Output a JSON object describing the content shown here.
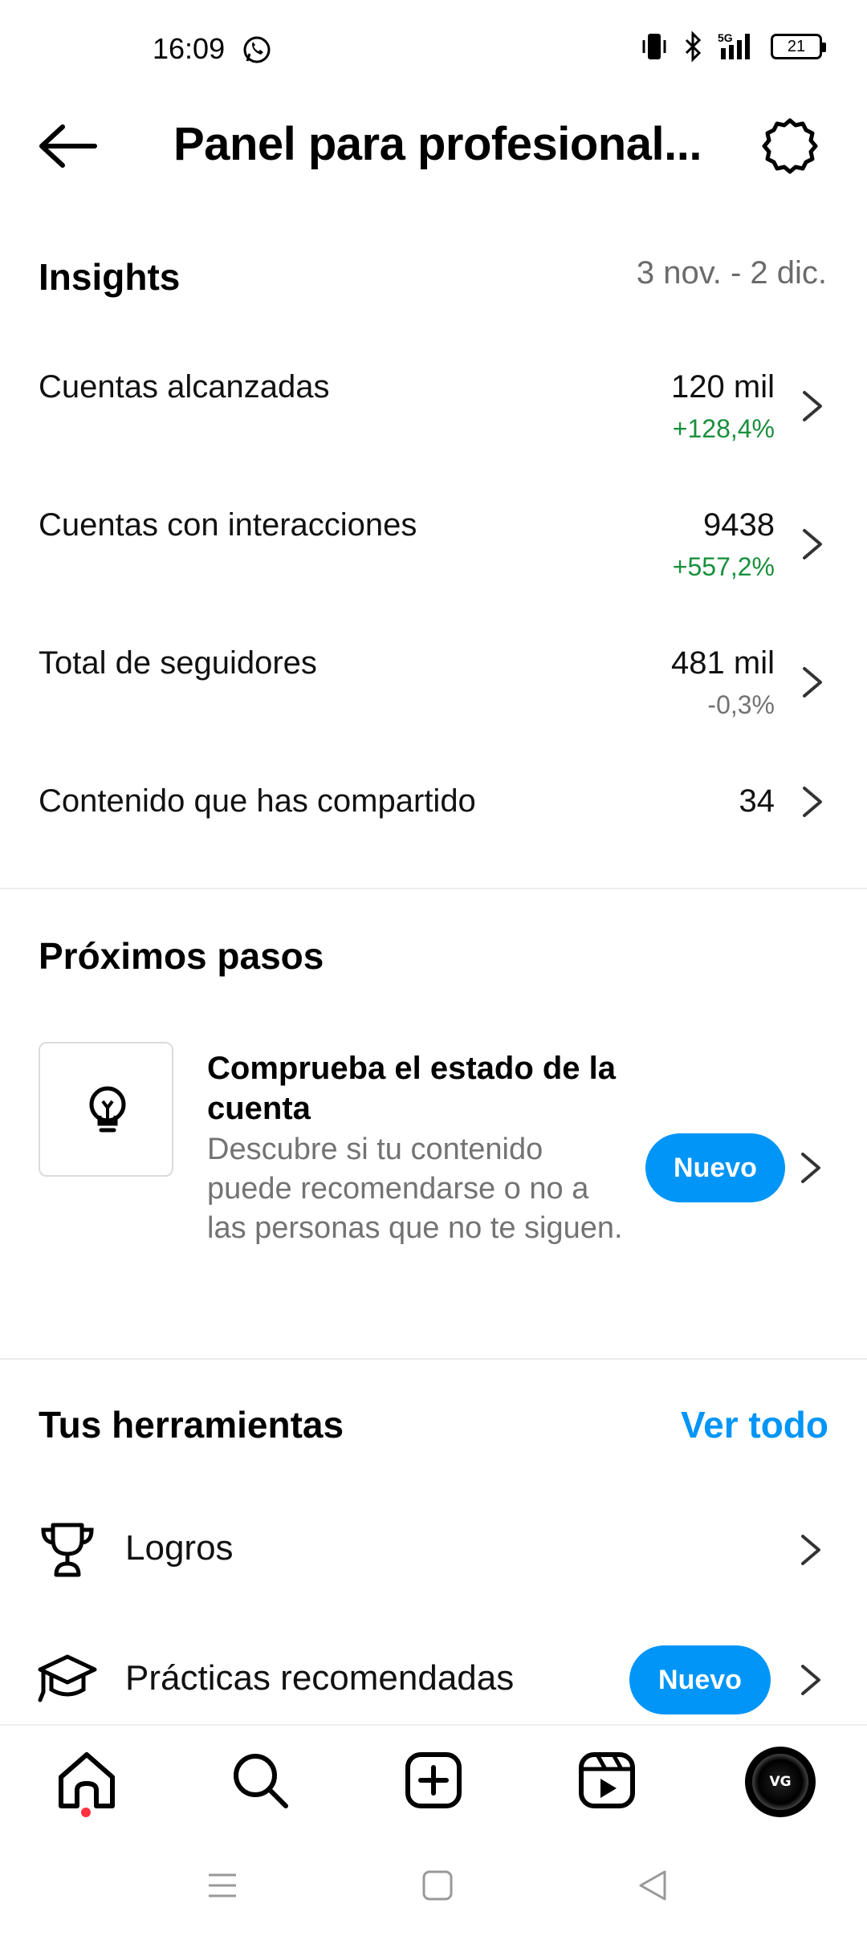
{
  "status_bar": {
    "time": "16:09",
    "network": "5G",
    "battery": "21"
  },
  "header": {
    "title": "Panel para profesional..."
  },
  "insights": {
    "title": "Insights",
    "date_range": "3 nov. - 2 dic.",
    "metrics": [
      {
        "label": "Cuentas alcanzadas",
        "value": "120 mil",
        "change": "+128,4%"
      },
      {
        "label": "Cuentas con interacciones",
        "value": "9438",
        "change": "+557,2%"
      },
      {
        "label": "Total de seguidores",
        "value": "481 mil",
        "change": "-0,3%"
      },
      {
        "label": "Contenido que has compartido",
        "value": "34",
        "change": ""
      }
    ]
  },
  "next_steps": {
    "title": "Próximos pasos",
    "card": {
      "title": "Comprueba el estado de la cuenta",
      "description": "Descubre si tu contenido puede recomendarse o no a las personas que no te siguen.",
      "badge": "Nuevo"
    }
  },
  "tools": {
    "title": "Tus herramientas",
    "see_all": "Ver todo",
    "items": [
      {
        "label": "Logros",
        "badge": ""
      },
      {
        "label": "Prácticas recomendadas",
        "badge": "Nuevo"
      }
    ]
  },
  "bottom_nav": {
    "avatar_text": "VG"
  },
  "colors": {
    "accent": "#0095f6",
    "positive": "#1a8f3c",
    "muted": "#737373",
    "notification": "#ff3040"
  }
}
